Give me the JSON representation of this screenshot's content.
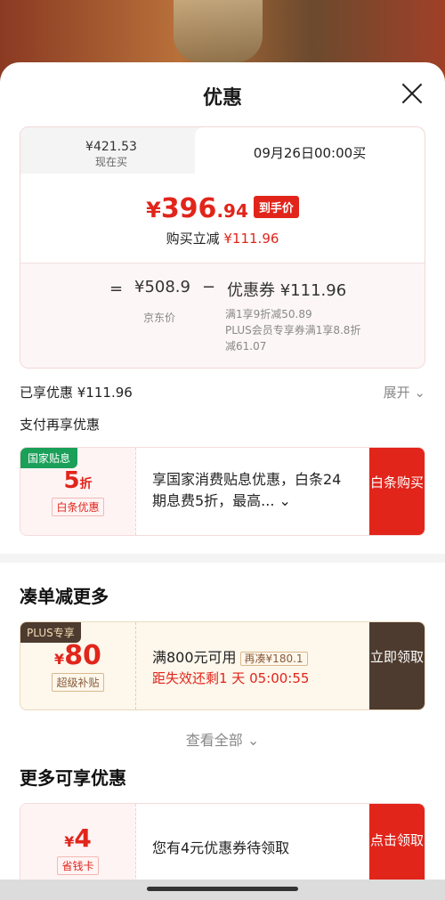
{
  "header": {
    "title": "优惠"
  },
  "price_card": {
    "tab_now_price": "¥421.53",
    "tab_now_label": "现在买",
    "tab_future": "09月26日00:00买",
    "final_yen": "¥",
    "final_int": "396",
    "final_dec": ".94",
    "final_badge": "到手价",
    "reduce_label": "购买立减",
    "reduce_value": "¥111.96",
    "eq": "=",
    "jd_price": "¥508.9",
    "jd_label": "京东价",
    "minus": "−",
    "coupon_total": "优惠券 ¥111.96",
    "coupon_detail_1": "满1享9折减50.89",
    "coupon_detail_2": "PLUS会员专享券满1享8.8折减61.07"
  },
  "summary": {
    "enjoyed": "已享优惠 ¥111.96",
    "expand": "展开 ⌄",
    "pay_more": "支付再享优惠"
  },
  "coupon_national": {
    "tag": "国家贴息",
    "amount": "5",
    "unit": "折",
    "sub": "白条优惠",
    "desc": "享国家消费贴息优惠，白条24期息费5折，最高... ⌄",
    "button": "白条购买"
  },
  "section1": {
    "title": "凑单减更多"
  },
  "coupon_plus": {
    "tag": "PLUS专享",
    "yen": "¥",
    "amount": "80",
    "sub": "超级补贴",
    "condition": "满800元可用",
    "pill": "再凑¥180.1",
    "expire": "距失效还剩1 天 05:00:55",
    "button": "立即领取"
  },
  "view_all": "查看全部 ⌄",
  "section2": {
    "title": "更多可享优惠"
  },
  "coupon_save": {
    "yen": "¥",
    "amount": "4",
    "sub": "省钱卡",
    "desc": "您有4元优惠券待领取",
    "button": "点击领取"
  }
}
